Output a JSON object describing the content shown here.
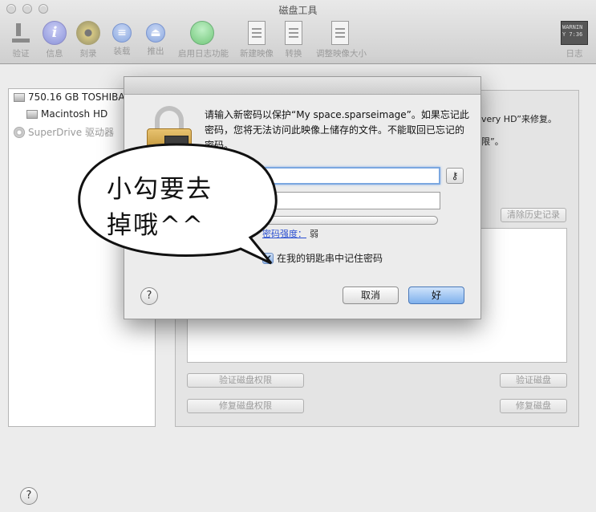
{
  "window": {
    "title": "磁盘工具"
  },
  "toolbar": {
    "verify": "验证",
    "info": "信息",
    "burn": "刻录",
    "mount": "装载",
    "eject": "推出",
    "enable_journaling": "启用日志功能",
    "new_image": "新建映像",
    "convert": "转换",
    "resize_image": "调整映像大小",
    "log": "日志",
    "log_icon_text": "WARNIN\nY 7:36"
  },
  "sidebar": {
    "items": [
      {
        "label": "750.16 GB TOSHIBA"
      },
      {
        "label": "Macintosh HD"
      },
      {
        "label": "SuperDrive 驱动器"
      }
    ]
  },
  "panel": {
    "text_line1": "very HD”来修复。",
    "text_line2": "限”。",
    "clear_history": "清除历史记录",
    "verify_permissions": "验证磁盘权限",
    "repair_permissions": "修复磁盘权限",
    "verify_disk": "验证磁盘",
    "repair_disk": "修复磁盘"
  },
  "dialog": {
    "message": "请输入新密码以保护“My space.sparseimage”。如果忘记此密码，您将无法访问此映像上储存的文件。不能取回已忘记的密码。",
    "password_value": "",
    "verify_value": "",
    "strength_label": "密码强度：",
    "strength_value": "弱",
    "remember_label": "在我的钥匙串中记住密码",
    "remember_checked": "✔",
    "cancel": "取消",
    "ok": "好",
    "help": "?"
  },
  "help_main": "?",
  "bubble": {
    "line1": "小勾要去",
    "line2": "掉哦^^"
  }
}
